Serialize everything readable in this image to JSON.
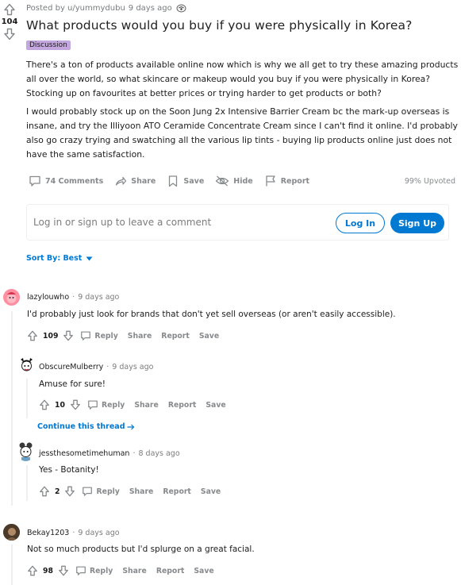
{
  "post": {
    "score": "104",
    "posted_by": "Posted by u/yummydubu",
    "time": "9 days ago",
    "title": "What products would you buy if you were physically in Korea?",
    "flair": "Discussion",
    "paragraphs": [
      "There's a ton of products available online now which is why we all get to try these amazing products all over the world, so what skincare or makeup would you buy if you were physically in Korea? Stocking up on favourites at better prices or trying harder to get products or both?",
      "I would probably stock up on the Soon Jung 2x Intensive Barrier Cream bc the mark-up overseas is insane, and try the Illiyoon ATO Ceramide Concentrate Cream since I can't find it online. I'd probably also go crazy trying and swatching all the various lip tints - buying lip products online just does not have the same satisfaction."
    ],
    "actions": {
      "comments": "74 Comments",
      "share": "Share",
      "save": "Save",
      "hide": "Hide",
      "report": "Report"
    },
    "upvoted": "99% Upvoted"
  },
  "login_prompt": {
    "text": "Log in or sign up to leave a comment",
    "login": "Log In",
    "signup": "Sign Up"
  },
  "sort": {
    "label": "Sort By: Best"
  },
  "comments": [
    {
      "author": "lazylouwho",
      "time": "9 days ago",
      "text": "I'd probably just look for brands that don't yet sell overseas (or aren't easily accessible).",
      "score": "109",
      "reply": "Reply",
      "share": "Share",
      "report": "Report",
      "save": "Save"
    },
    {
      "author": "ObscureMulberry",
      "time": "9 days ago",
      "text": "Amuse for sure!",
      "score": "10",
      "reply": "Reply",
      "share": "Share",
      "report": "Report",
      "save": "Save"
    },
    {
      "author": "jessthesometimehuman",
      "time": "8 days ago",
      "text": "Yes - Botanity!",
      "score": "2",
      "reply": "Reply",
      "share": "Share",
      "report": "Report",
      "save": "Save"
    },
    {
      "author": "Bekay1203",
      "time": "9 days ago",
      "text": "Not so much products but I'd splurge on a great facial.",
      "score": "98",
      "reply": "Reply",
      "share": "Share",
      "report": "Report",
      "save": "Save"
    }
  ],
  "continue_thread": "Continue this thread",
  "colors": {
    "accent": "#0079d3",
    "flair_bg": "#c4a7de",
    "muted": "#878a8c"
  }
}
